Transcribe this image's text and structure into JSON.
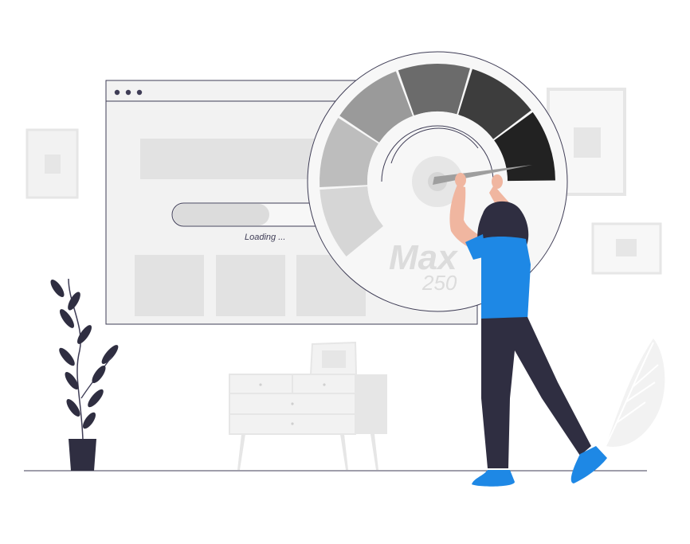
{
  "browser": {
    "loading_label": "Loading ..."
  },
  "gauge": {
    "max_label": "Max",
    "max_value": "250",
    "segment_colors": [
      "#d6d6d6",
      "#bdbdbd",
      "#9a9a9a",
      "#6b6b6b",
      "#3d3d3d",
      "#222222"
    ]
  },
  "colors": {
    "accent_blue": "#1e88e5",
    "dark_navy": "#2f2e41",
    "frame_gray": "#ececec",
    "light_gray": "#f2f2f2"
  }
}
